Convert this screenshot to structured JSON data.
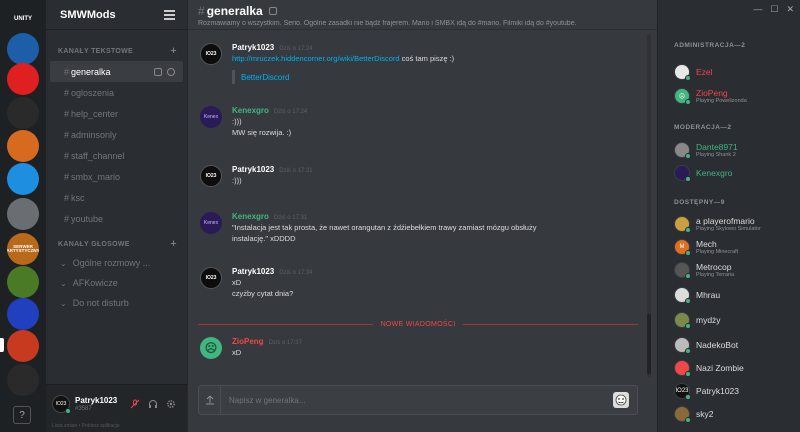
{
  "servers": [
    {
      "name": "brand-logo",
      "label": "UNITY",
      "bg": "#1e2124",
      "fg": "#fff"
    },
    {
      "name": "server-flame",
      "label": "",
      "bg": "#1c5fa8",
      "fg": "#fff"
    },
    {
      "name": "server-record",
      "label": "",
      "bg": "#e02020",
      "fg": "#fff"
    },
    {
      "name": "server-ts",
      "label": "",
      "bg": "#2a2a2a",
      "fg": "#fff"
    },
    {
      "name": "server-mario",
      "label": "",
      "bg": "#d86a20",
      "fg": "#fff"
    },
    {
      "name": "server-blue-bird",
      "label": "",
      "bg": "#1e8fe0",
      "fg": "#fff"
    },
    {
      "name": "server-bird",
      "label": "",
      "bg": "#6a6e72",
      "fg": "#fff"
    },
    {
      "name": "server-serwer-artystyczny",
      "label": "SERWER ARTYSTYCZNY",
      "bg": "#b8691a",
      "fg": "#fff"
    },
    {
      "name": "server-green",
      "label": "",
      "bg": "#4a7a26",
      "fg": "#fff"
    },
    {
      "name": "server-purple",
      "label": "",
      "bg": "#2040c0",
      "fg": "#fff"
    },
    {
      "name": "server-smw",
      "label": "",
      "bg": "#c83a20",
      "fg": "#fff"
    },
    {
      "name": "server-space",
      "label": "",
      "bg": "#2a2a2a",
      "fg": "#fff"
    }
  ],
  "help_label": "?",
  "guild": {
    "name": "SMWMods"
  },
  "text_category": "KANAŁY TEKSTOWE",
  "text_channels": [
    "generalka",
    "ogloszenia",
    "help_center",
    "adminsonly",
    "staff_channel",
    "smbx_mario",
    "ksc",
    "youtube"
  ],
  "voice_category": "KANAŁY GŁOSOWE",
  "voice_channels": [
    "Ogólne rozmowy ...",
    "AFKowicze",
    "Do not disturb"
  ],
  "user": {
    "name": "Patryk1023",
    "tag": "#3587",
    "avatar_text": "IO23",
    "links": "Lista zmian  •  Pobierz aplikacje"
  },
  "channel": {
    "title": "generalka",
    "topic": "Rozmawiamy o wszystkim. Serio. Ogólne zasadki nie bądź frajerem. Mario i SMBX idą do #mario. Filmiki idą do #youtube."
  },
  "messages": [
    {
      "author": "Patryk1023",
      "time": "Dziś o 17:24",
      "color": "#ffffff",
      "av": "IO23",
      "avclass": "av-io",
      "lines": [
        {
          "link": "http://mruczek.hiddencorner.org/wiki/BetterDiscord",
          "text": " coś tam piszę :)"
        }
      ],
      "embed": "BetterDiscord"
    },
    {
      "author": "Kenexgro",
      "time": "Dziś o 17:24",
      "color": "#43b581",
      "av": "Kenex",
      "avclass": "av-kx",
      "lines": [
        {
          "text": ":)))"
        },
        {
          "text": "MW się rozwija. :)"
        }
      ]
    },
    {
      "author": "Patryk1023",
      "time": "Dziś o 17:31",
      "color": "#ffffff",
      "av": "IO23",
      "avclass": "av-io",
      "lines": [
        {
          "text": ":)))"
        }
      ]
    },
    {
      "author": "Kenexgro",
      "time": "Dziś o 17:31",
      "color": "#43b581",
      "av": "Kenex",
      "avclass": "av-kx",
      "lines": [
        {
          "text": "\"Instalacja jest tak prosta, że nawet orangutan z źdźiebełkiem trawy zamiast mózgu obsłuży"
        },
        {
          "text": "instalację.\" xDDDD"
        }
      ]
    },
    {
      "author": "Patryk1023",
      "time": "Dziś o 17:34",
      "color": "#ffffff",
      "av": "IO23",
      "avclass": "av-io",
      "lines": [
        {
          "text": "xD"
        },
        {
          "text": "czyżby cytat dnia?"
        }
      ]
    },
    {
      "author": "ZioPeng",
      "time": "Dziś o 17:37",
      "color": "#f04747",
      "av": "☹",
      "avclass": "av-zp",
      "lines": [
        {
          "text": "xD"
        }
      ]
    }
  ],
  "new_messages_label": "NOWE WIADOMOŚCI",
  "composer": {
    "placeholder": "Napisz w generalka..."
  },
  "member_categories": [
    "ADMINISTRACJA—2",
    "MODERACJA—2",
    "DOSTĘPNY—9"
  ],
  "members": [
    {
      "cat": 0,
      "name": "Ezel",
      "status": "",
      "color": "red",
      "av": "",
      "bg": "#e8e8e8"
    },
    {
      "cat": 0,
      "name": "ZioPeng",
      "status": "Playing Powelizonda",
      "color": "red",
      "av": "☹",
      "bg": "#43b581"
    },
    {
      "cat": 1,
      "name": "Dante8971",
      "status": "Playing Shank 2",
      "color": "green",
      "av": "",
      "bg": "#888"
    },
    {
      "cat": 1,
      "name": "Kenexgro",
      "status": "",
      "color": "green",
      "av": "",
      "bg": "#2a1a55"
    },
    {
      "cat": 2,
      "name": "a playerofmario",
      "status": "Playing Skylowo Simulator",
      "color": "",
      "av": "",
      "bg": "#c8a040"
    },
    {
      "cat": 2,
      "name": "Mech",
      "status": "Playing Minecraft",
      "color": "",
      "av": "M",
      "bg": "#e07020"
    },
    {
      "cat": 2,
      "name": "Metrocop",
      "status": "Playing Terraria",
      "color": "",
      "av": "",
      "bg": "#555"
    },
    {
      "cat": 2,
      "name": "Mhrau",
      "status": "",
      "color": "",
      "av": "",
      "bg": "#ddd"
    },
    {
      "cat": 2,
      "name": "mydży",
      "status": "",
      "color": "",
      "av": "",
      "bg": "#7a8a4a"
    },
    {
      "cat": 2,
      "name": "NadekoBot",
      "status": "",
      "color": "",
      "av": "",
      "bg": "#bbb"
    },
    {
      "cat": 2,
      "name": "Nazi Zombie",
      "status": "",
      "color": "",
      "av": "",
      "bg": "#f04747"
    },
    {
      "cat": 2,
      "name": "Patryk1023",
      "status": "",
      "color": "",
      "av": "IO23",
      "bg": "#111"
    },
    {
      "cat": 2,
      "name": "sky2",
      "status": "",
      "color": "",
      "av": "",
      "bg": "#8a6a3a"
    }
  ]
}
